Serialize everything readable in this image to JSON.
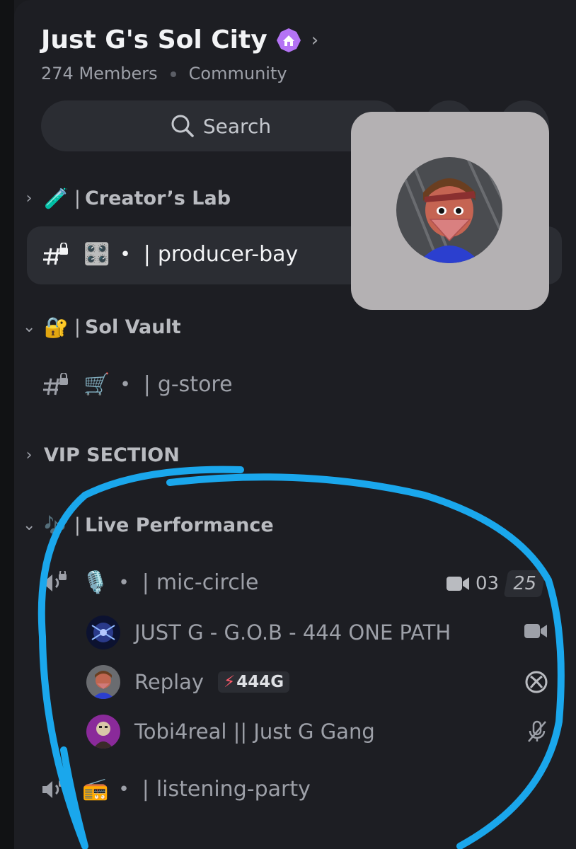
{
  "server": {
    "name": "Just G's Sol City",
    "members": "274 Members",
    "type": "Community"
  },
  "search": {
    "label": "Search"
  },
  "categories": {
    "creators_lab": "Creator’s Lab",
    "sol_vault": "Sol Vault",
    "vip": "VIP SECTION",
    "live_performance": "Live Performance"
  },
  "channels": {
    "producer_bay": "producer-bay",
    "g_store": "g-store",
    "mic_circle": "mic-circle",
    "listening_party": "listening-party"
  },
  "voice": {
    "connected": "03",
    "limit": "25"
  },
  "members": [
    {
      "name": "JUST G - G.O.B - 444 ONE PATH",
      "status_icon": "video-icon"
    },
    {
      "name": "Replay",
      "tag": "444G",
      "status_icon": "xbox-icon"
    },
    {
      "name": "Tobi4real || Just G Gang",
      "status_icon": "muted-mic-icon"
    }
  ],
  "symbols": {
    "bullet": "•",
    "pipe": "|"
  },
  "colors": {
    "annotation": "#1aa7ec",
    "boost": "#b473f5"
  }
}
